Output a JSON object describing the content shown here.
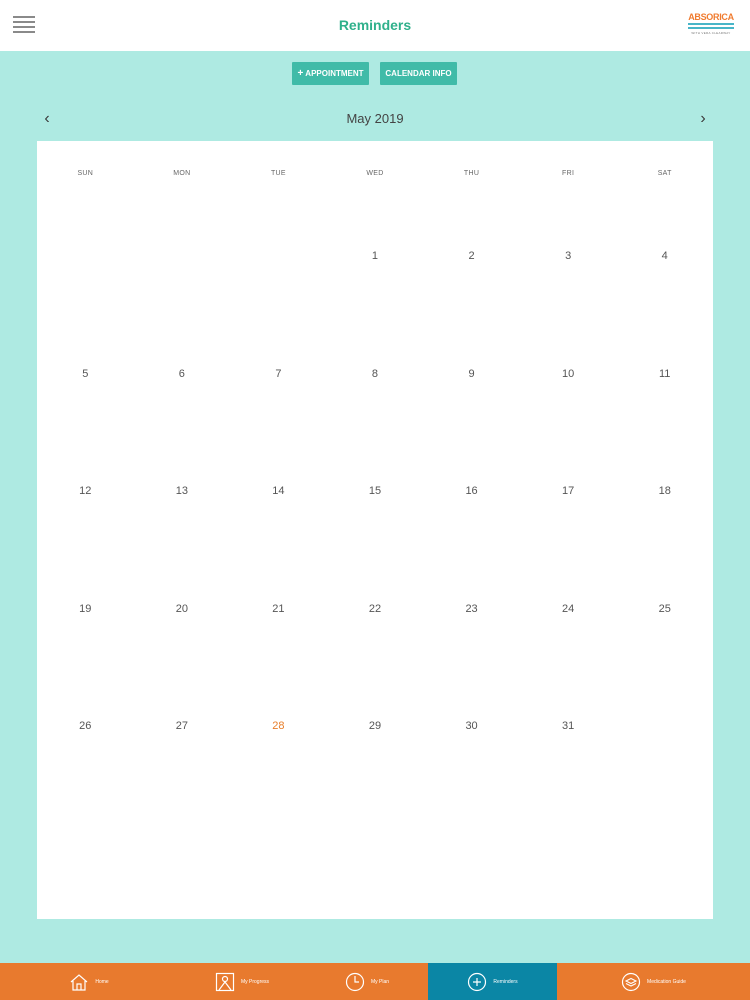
{
  "header": {
    "title": "Reminders",
    "logo_text": "ABSORICA",
    "logo_tagline": "WITH VERA CLEARWAY"
  },
  "actions": {
    "appointment_label": "APPOINTMENT",
    "calendar_info_label": "CALENDAR INFO"
  },
  "calendar": {
    "month_title": "May 2019",
    "weekdays": [
      "SUN",
      "MON",
      "TUE",
      "WED",
      "THU",
      "FRI",
      "SAT"
    ],
    "days": [
      "",
      "",
      "",
      "1",
      "2",
      "3",
      "4",
      "5",
      "6",
      "7",
      "8",
      "9",
      "10",
      "11",
      "12",
      "13",
      "14",
      "15",
      "16",
      "17",
      "18",
      "19",
      "20",
      "21",
      "22",
      "23",
      "24",
      "25",
      "26",
      "27",
      "28",
      "29",
      "30",
      "31",
      ""
    ],
    "today": "28",
    "today_color": "#e87e2a"
  },
  "tabs": [
    {
      "label": "Home",
      "icon": "home-icon"
    },
    {
      "label": "My Progress",
      "icon": "progress-icon"
    },
    {
      "label": "My Plan",
      "icon": "clock-icon"
    },
    {
      "label": "Reminders",
      "icon": "plus-circle-icon",
      "active": true
    },
    {
      "label": "Medication Guide",
      "icon": "layers-icon"
    }
  ],
  "colors": {
    "accent": "#2fb08b",
    "background": "#aeeae2",
    "tabbar": "#e87a2e",
    "tab_active": "#0b86a5",
    "button": "#40bba8"
  }
}
